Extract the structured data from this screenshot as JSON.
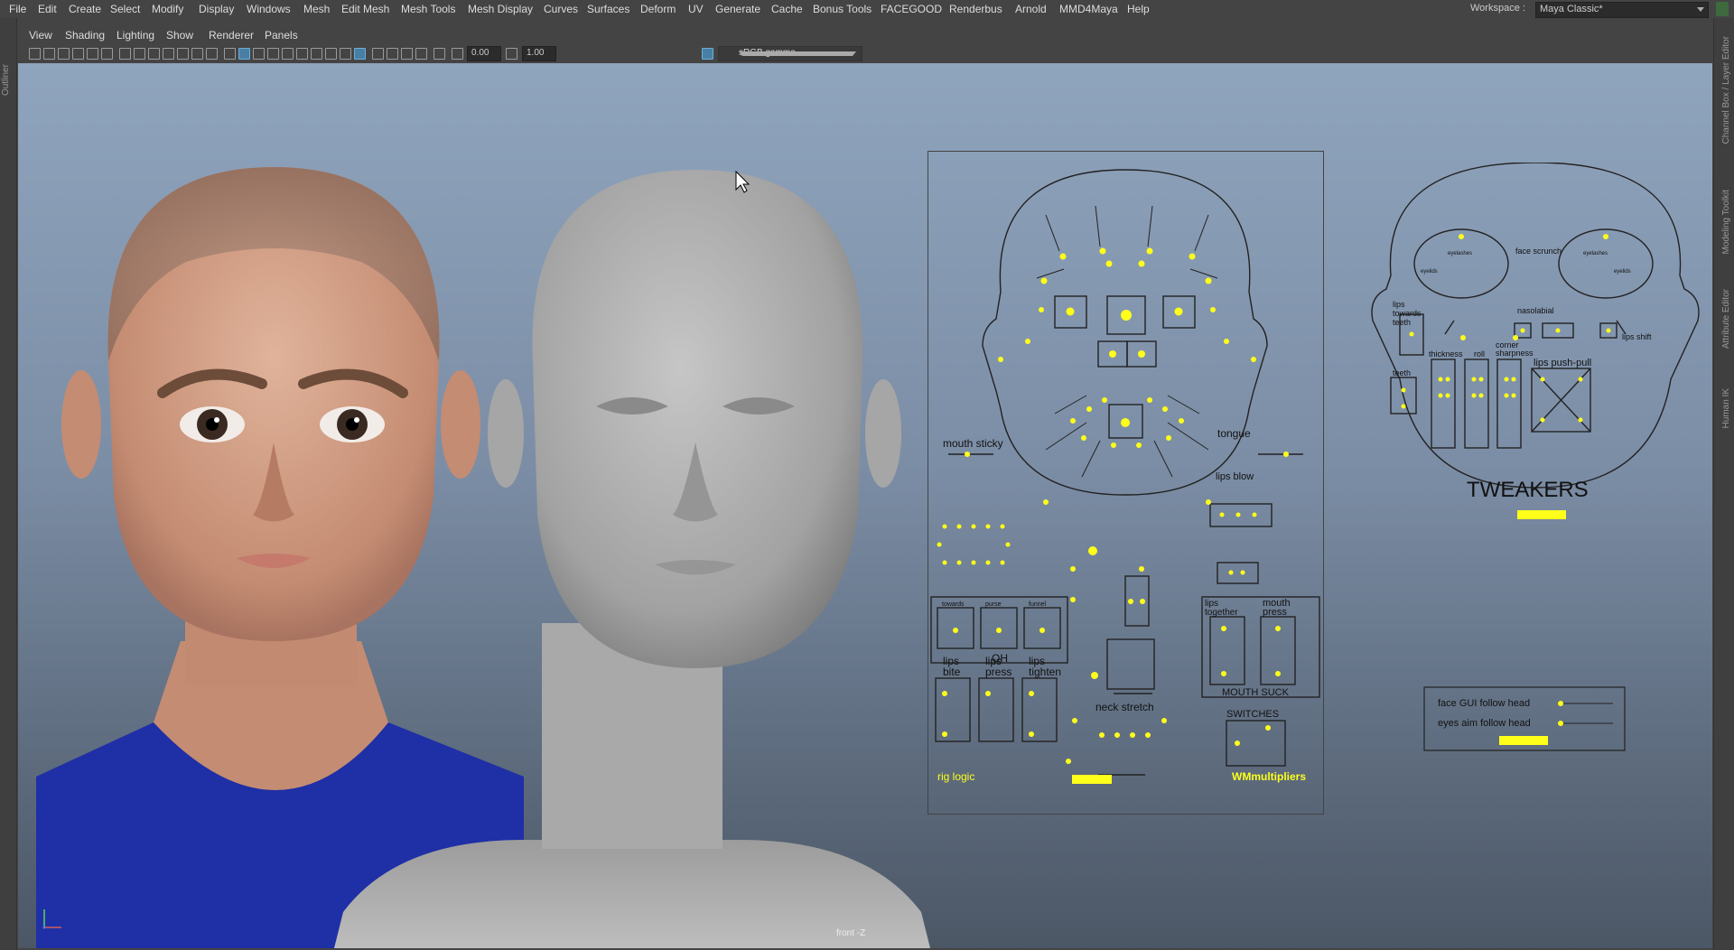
{
  "menubar": {
    "items": [
      "File",
      "Edit",
      "Create",
      "Select",
      "Modify",
      "Display",
      "Windows",
      "Mesh",
      "Edit Mesh",
      "Mesh Tools",
      "Mesh Display",
      "Curves",
      "Surfaces",
      "Deform",
      "UV",
      "Generate",
      "Cache",
      "Bonus Tools",
      "FACEGOOD",
      "Renderbus",
      "Arnold",
      "MMD4Maya",
      "Help"
    ],
    "workspace_label": "Workspace :",
    "workspace_value": "Maya Classic*"
  },
  "left_bar": {
    "label": "Outliner"
  },
  "right_bar": {
    "tabs": [
      "Channel Box / Layer Editor",
      "Modeling Toolkit",
      "Attribute Editor",
      "Human IK"
    ]
  },
  "panel_menu": {
    "items": [
      "View",
      "Shading",
      "Lighting",
      "Show",
      "Renderer",
      "Panels"
    ]
  },
  "toolbar": {
    "near_clip": "0.00",
    "far_clip": "1.00",
    "color_space": "sRGB gamma"
  },
  "viewport": {
    "camera": "front -Z"
  },
  "rig_gui": {
    "mouth_sticky": "mouth sticky",
    "tongue": "tongue",
    "lips_blow": "lips blow",
    "towards": "towards",
    "purse": "purse",
    "funnel": "funnel",
    "oh": "OH",
    "lips_together_1": "lips",
    "lips_together_2": "together",
    "mouth_press_1": "mouth",
    "mouth_press_2": "press",
    "mouth_suck": "MOUTH SUCK",
    "lips_bite_1": "lips",
    "lips_bite_2": "bite",
    "lips_press_1": "lips",
    "lips_press_2": "press",
    "lips_tighten_1": "lips",
    "lips_tighten_2": "tighten",
    "neck_stretch": "neck stretch",
    "switches": "SWITCHES",
    "rig_logic": "rig logic",
    "wm_multipliers": "WMmultipliers"
  },
  "tweakers": {
    "face_scrunch": "face scrunch",
    "eyelashes": "eyelashes",
    "eyelids": "eyelids",
    "nasolabial": "nasolabial",
    "lips_towards_teeth_1": "lips",
    "lips_towards_teeth_2": "towards",
    "lips_towards_teeth_3": "teeth",
    "lips_shift": "lips shift",
    "teeth": "teeth",
    "thickness": "thickness",
    "roll": "roll",
    "corner_sharpness_1": "corner",
    "corner_sharpness_2": "sharpness",
    "lips_push_pull": "lips push-pull",
    "title": "TWEAKERS"
  },
  "follow_panel": {
    "face_gui_follow": "face GUI follow head",
    "eyes_aim_follow": "eyes aim follow head"
  },
  "colors": {
    "control_yellow": "#ffff1a",
    "viewport_top": "#8fa4bd",
    "viewport_bottom": "#4c5766",
    "skin": "#d6a58c",
    "shirt": "#1e2fa8",
    "neutral_head": "#a8a8a8"
  }
}
